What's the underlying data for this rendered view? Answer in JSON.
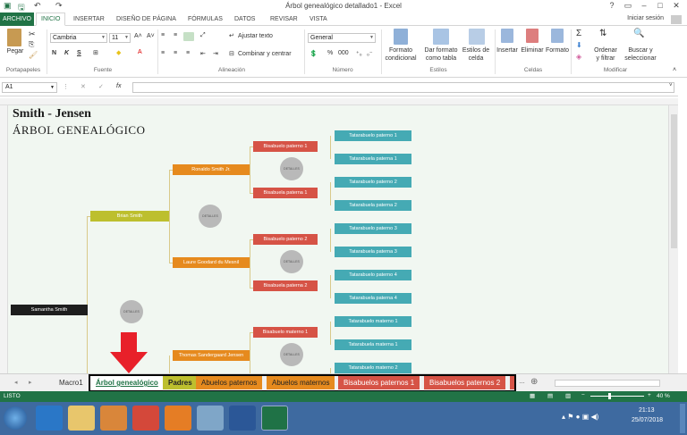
{
  "window": {
    "title": "Árbol genealógico detallado1 - Excel",
    "help": "?",
    "minimize": "–",
    "restore": "□",
    "close": "✕"
  },
  "quick_access": {
    "save": "🖫",
    "undo": "↶",
    "redo": "↷"
  },
  "ribbon_tabs": [
    "ARCHIVO",
    "INICIO",
    "INSERTAR",
    "DISEÑO DE PÁGINA",
    "FÓRMULAS",
    "DATOS",
    "REVISAR",
    "VISTA"
  ],
  "signin": "Iniciar sesión",
  "ribbon": {
    "paste": "Pegar",
    "font_name": "Cambria",
    "font_size": "11",
    "bold": "N",
    "italic": "K",
    "underline": "S",
    "wrap_text": "Ajustar texto",
    "merge_center": "Combinar y centrar",
    "number_format": "General",
    "percent": "%",
    "thousands": "000",
    "cond_format": [
      "Formato",
      "condicional"
    ],
    "format_table": [
      "Dar formato",
      "como tabla"
    ],
    "cell_styles": [
      "Estilos de",
      "celda"
    ],
    "insert": "Insertar",
    "delete": "Eliminar",
    "format": "Formato",
    "sort_filter": [
      "Ordenar",
      "y filtrar"
    ],
    "find_select": [
      "Buscar y",
      "seleccionar"
    ],
    "groups": [
      "Portapapeles",
      "Fuente",
      "Alineación",
      "Número",
      "Estilos",
      "Celdas",
      "Modificar"
    ]
  },
  "formula_bar": {
    "name_box": "A1",
    "fx": "fx",
    "cancel": "✕",
    "enter": "✓"
  },
  "sheet": {
    "title": "Smith - Jensen",
    "subtitle": "ÁRBOL GENEALÓGICO",
    "root": "Samantha Smith",
    "parents": [
      "Brian Smith"
    ],
    "grandparents": [
      "Ronaldo Smith Jr.",
      "Laure Goodard du Mesnil",
      "Thomas Sandergaard Jensen"
    ],
    "great_grandparents": [
      "Bisabuelo paterno 1",
      "Bisabuela paterna 1",
      "Bisabuelo paterno 2",
      "Bisabuela paterna 2",
      "Bisabuelo materno 1"
    ],
    "great_great": [
      "Tatarabuelo paterno 1",
      "Tatarabuela paterna 1",
      "Tatarabuelo paterno 2",
      "Tatarabuela paterna 2",
      "Tatarabuelo paterno 3",
      "Tatarabuela paterna 3",
      "Tatarabuelo paterno 4",
      "Tatarabuela paterna 4",
      "Tatarabuelo materno 1",
      "Tatarabuela materna 1",
      "Tatarabuelo materno 2"
    ],
    "details_label": "DETALLES"
  },
  "sheet_tabs": [
    "Macro1",
    "Árbol genealógico",
    "Padres",
    "Abuelos paternos",
    "Abuelos maternos",
    "Bisabuelos paternos 1",
    "Bisabuelos paternos 2"
  ],
  "status": {
    "ready": "LISTO",
    "zoom": "40 %",
    "zoom_minus": "−",
    "zoom_plus": "+"
  },
  "taskbar": {
    "time": "21:13",
    "date": "25/07/2018"
  },
  "colors": {
    "excel_green": "#217346",
    "tata": "#45aab4",
    "bis": "#d65346",
    "abu": "#e68a1e",
    "pad": "#bdbf2e",
    "arrow": "#e8202a"
  }
}
